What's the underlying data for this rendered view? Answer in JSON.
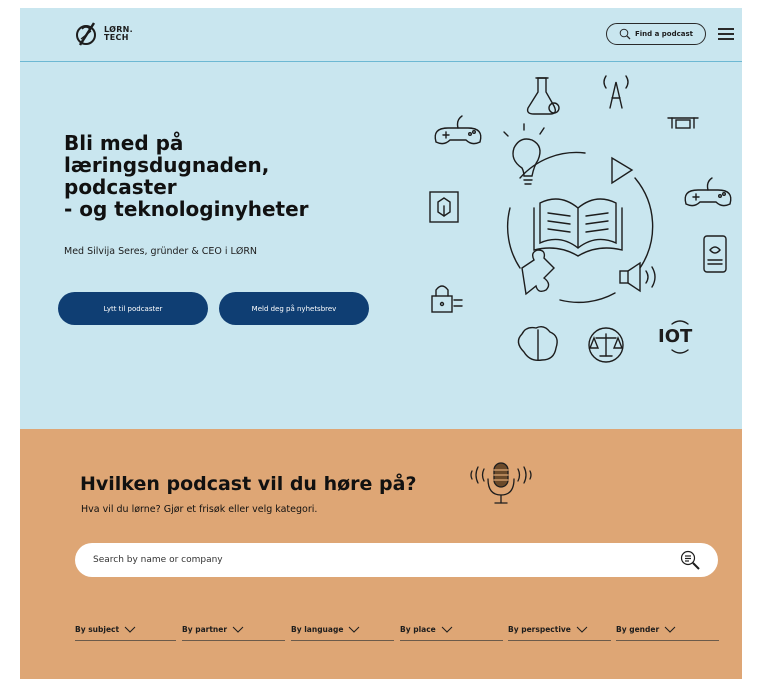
{
  "header": {
    "logo_line1": "LØRN.",
    "logo_line2": "TECH",
    "find_label": "Find a podcast"
  },
  "hero": {
    "title_lines": [
      "Bli med på",
      "læringsdugnaden,",
      "podcaster",
      "- og teknologinyheter"
    ],
    "subtitle": "Med Silvija Seres, gründer & CEO i LØRN",
    "btn_podcast": "Lytt til podcaster",
    "btn_news": "Meld deg på nyhetsbrev",
    "iot_label": "IOT"
  },
  "podcast": {
    "title": "Hvilken podcast vil du høre på?",
    "subtitle": "Hva vil du lørne? Gjør et frisøk eller velg kategori.",
    "search_placeholder": "Search by name or company",
    "filters": [
      {
        "label": "By subject"
      },
      {
        "label": "By partner"
      },
      {
        "label": "By language"
      },
      {
        "label": "By place"
      },
      {
        "label": "By perspective"
      },
      {
        "label": "By gender"
      }
    ]
  },
  "colors": {
    "hero_bg": "#c9e6ef",
    "orange_bg": "#dea675",
    "button_bg": "#0f3e73"
  }
}
